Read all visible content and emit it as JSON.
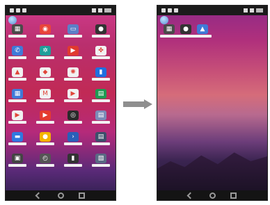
{
  "left_phone": {
    "apps": [
      {
        "icon": "app-grid-icon",
        "color": "#4a4a4a",
        "glyph": "▦"
      },
      {
        "icon": "chrome-icon",
        "color": "#e9453a",
        "glyph": "◉"
      },
      {
        "icon": "files-icon",
        "color": "#5c7fc7",
        "glyph": "▭"
      },
      {
        "icon": "camera-icon",
        "color": "#333333",
        "glyph": "●"
      },
      {
        "icon": "phone-icon",
        "color": "#3f7ad8",
        "glyph": "✆"
      },
      {
        "icon": "settings-icon",
        "color": "#1f9f9a",
        "glyph": "✲"
      },
      {
        "icon": "youtube-music-icon",
        "color": "#e03a2f",
        "glyph": "▶"
      },
      {
        "icon": "photos-icon",
        "color": "#f1f1f1",
        "glyph": "✤"
      },
      {
        "icon": "drive-icon",
        "color": "#f1f1f1",
        "glyph": "▲"
      },
      {
        "icon": "maps-icon",
        "color": "#f1f1f1",
        "glyph": "◆"
      },
      {
        "icon": "photos-alt-icon",
        "color": "#f1f1f1",
        "glyph": "✺"
      },
      {
        "icon": "duo-icon",
        "color": "#1f6fe0",
        "glyph": "▮"
      },
      {
        "icon": "calendar-icon",
        "color": "#3f7ad8",
        "glyph": "▦"
      },
      {
        "icon": "gmail-icon",
        "color": "#f1f1f1",
        "glyph": "M"
      },
      {
        "icon": "play-movies-icon",
        "color": "#f1f1f1",
        "glyph": "▶"
      },
      {
        "icon": "sheets-icon",
        "color": "#1e9a52",
        "glyph": "▤"
      },
      {
        "icon": "play-store-icon",
        "color": "#f1f1f1",
        "glyph": "▶"
      },
      {
        "icon": "youtube-icon",
        "color": "#e53b2f",
        "glyph": "▶"
      },
      {
        "icon": "camera-app-icon",
        "color": "#2a2a2a",
        "glyph": "◎"
      },
      {
        "icon": "file-manager-icon",
        "color": "#7c8bb7",
        "glyph": "▤"
      },
      {
        "icon": "messages-icon",
        "color": "#2f78e0",
        "glyph": "▬"
      },
      {
        "icon": "keep-icon",
        "color": "#f4b400",
        "glyph": "●"
      },
      {
        "icon": "terminal-icon",
        "color": "#2a5fb8",
        "glyph": "›"
      },
      {
        "icon": "dev-tools-icon",
        "color": "#3c4f6b",
        "glyph": "▤"
      },
      {
        "icon": "android-icon",
        "color": "#444444",
        "glyph": "▣"
      },
      {
        "icon": "clock-icon",
        "color": "#555555",
        "glyph": "◴"
      },
      {
        "icon": "video-icon",
        "color": "#333333",
        "glyph": "▮"
      },
      {
        "icon": "gallery-icon",
        "color": "#5a6a84",
        "glyph": "▧"
      }
    ]
  },
  "right_phone": {
    "apps": [
      {
        "icon": "app-grid-icon",
        "color": "#4a4a4a",
        "glyph": "▦"
      },
      {
        "icon": "camera-icon",
        "color": "#333333",
        "glyph": "●"
      },
      {
        "icon": "android-bot-icon",
        "color": "#3f7ad8",
        "glyph": "▲"
      }
    ]
  },
  "transition": {
    "icon": "right-arrow-icon",
    "color": "#8f8f8f"
  }
}
